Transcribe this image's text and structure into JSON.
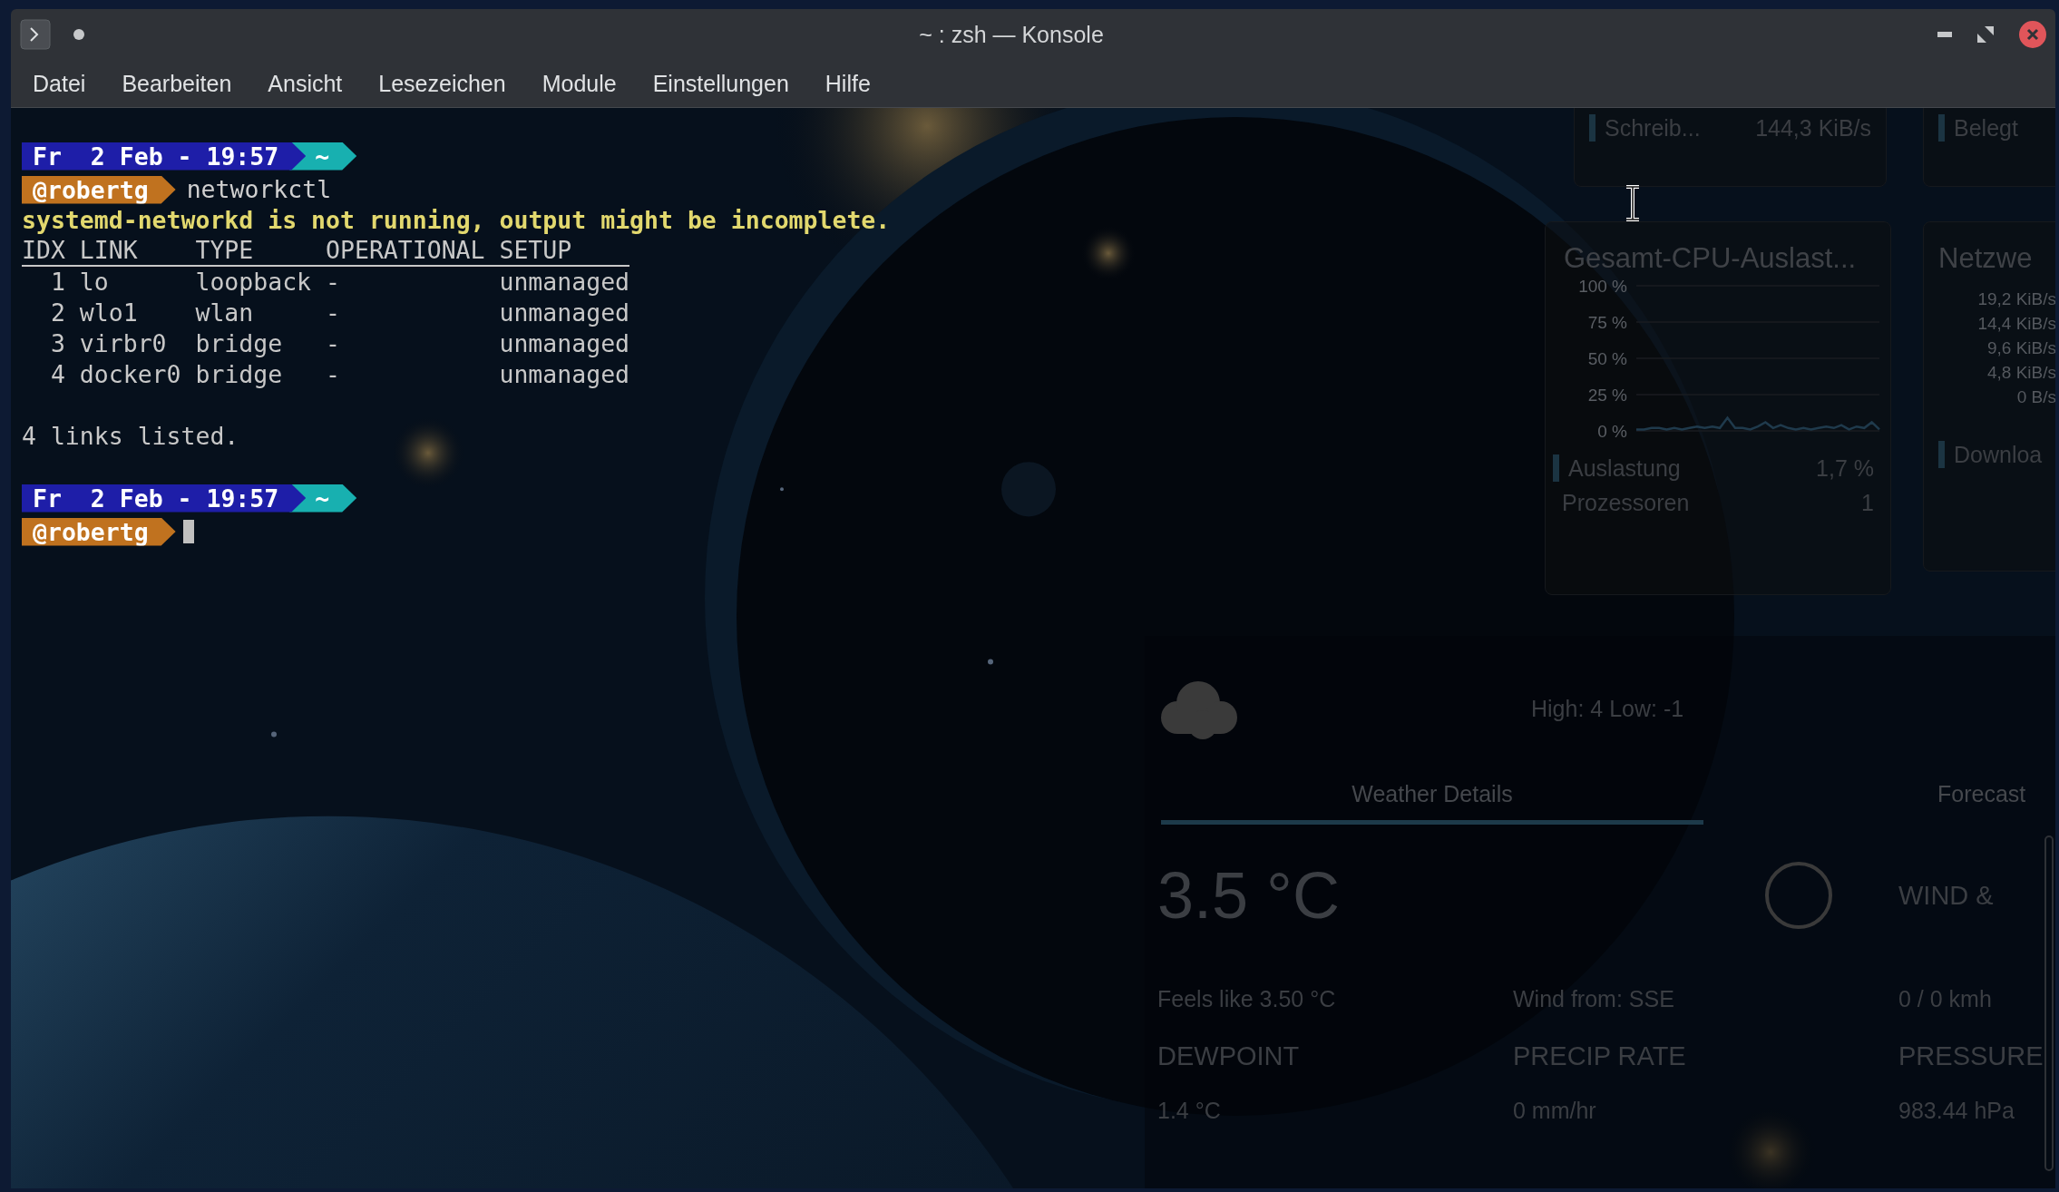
{
  "window": {
    "title": "~ : zsh — Konsole"
  },
  "menu": [
    "Datei",
    "Bearbeiten",
    "Ansicht",
    "Lesezeichen",
    "Module",
    "Einstellungen",
    "Hilfe"
  ],
  "terminal": {
    "lines": [
      {
        "kind": "prompt",
        "date": "Fr  2 Feb - 19:57",
        "dir": "~",
        "user": "@robertg",
        "command": "networkctl",
        "cursor": false
      },
      {
        "kind": "warning",
        "text": "systemd-networkd is not running, output might be incomplete."
      },
      {
        "kind": "table_header",
        "cells": [
          "IDX",
          "LINK",
          "TYPE",
          "OPERATIONAL",
          "SETUP"
        ]
      },
      {
        "kind": "table_row",
        "cells": [
          "1",
          "lo",
          "loopback",
          "-",
          "unmanaged"
        ]
      },
      {
        "kind": "table_row",
        "cells": [
          "2",
          "wlo1",
          "wlan",
          "-",
          "unmanaged"
        ]
      },
      {
        "kind": "table_row",
        "cells": [
          "3",
          "virbr0",
          "bridge",
          "-",
          "unmanaged"
        ]
      },
      {
        "kind": "table_row",
        "cells": [
          "4",
          "docker0",
          "bridge",
          "-",
          "unmanaged"
        ]
      },
      {
        "kind": "blank"
      },
      {
        "kind": "output",
        "text": "4 links listed."
      },
      {
        "kind": "blank"
      },
      {
        "kind": "prompt",
        "date": "Fr  2 Feb - 19:57",
        "dir": "~",
        "user": "@robertg",
        "cursor": true
      }
    ]
  },
  "disk_widget": {
    "rows": [
      {
        "label": "Schreib...",
        "value": "144,3 KiB/s",
        "color": "#1b3442"
      }
    ]
  },
  "memory_widget": {
    "rows": [
      {
        "label": "Belegt",
        "color": "#1b3442"
      }
    ]
  },
  "cpu_widget": {
    "title": "Gesamt-CPU-Auslast...",
    "chart_data": {
      "type": "line",
      "grid": true,
      "ylim": [
        0,
        100
      ],
      "yticks": [
        {
          "value": 100,
          "label": "100 %"
        },
        {
          "value": 75,
          "label": "75 %"
        },
        {
          "value": 50,
          "label": "50 %"
        },
        {
          "value": 25,
          "label": "25 %"
        },
        {
          "value": 0,
          "label": "0 %"
        }
      ],
      "series": [
        {
          "color": "#1f3a4c",
          "values": [
            1,
            1,
            2,
            2,
            1,
            2,
            1,
            2,
            3,
            2,
            3,
            2,
            9,
            2,
            2,
            1,
            3,
            6,
            2,
            4,
            2,
            1,
            2,
            1,
            2,
            3,
            2,
            4,
            1,
            3,
            2,
            6,
            1
          ]
        }
      ]
    },
    "rows": [
      {
        "label": "Auslastung",
        "value": "1,7 %",
        "color": "#1b3442"
      },
      {
        "label": "Prozessoren",
        "value": "1"
      }
    ]
  },
  "network_widget": {
    "title": "Netzwe",
    "axis_labels": [
      "19,2 KiB/s",
      "14,4 KiB/s",
      "9,6 KiB/s",
      "4,8 KiB/s",
      "0 B/s"
    ],
    "rows": [
      {
        "label": "Downloa",
        "color": "#1b3442"
      }
    ]
  },
  "weather_widget": {
    "high_low": "High: 4 Low: -1",
    "tabs": [
      {
        "label": "Weather Details",
        "selected": true
      },
      {
        "label": "Forecast",
        "selected": false
      }
    ],
    "temperature": "3.5 °C",
    "wind_heading": "WIND &",
    "feels_like": "Feels like 3.50 °C",
    "wind_from": "Wind from: SSE",
    "wind_speed": "0 / 0 kmh",
    "details": [
      {
        "heading": "DEWPOINT",
        "value": "1.4 °C"
      },
      {
        "heading": "PRECIP RATE",
        "value": "0 mm/hr"
      },
      {
        "heading": "PRESSURE",
        "value": "983.44 hPa"
      }
    ]
  }
}
